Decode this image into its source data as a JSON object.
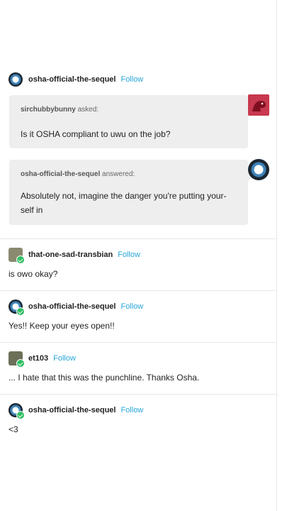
{
  "original_post": {
    "blog_name": "osha-official-the-sequel",
    "follow_label": "Follow",
    "ask": {
      "asker_name": "sirchubbybunny",
      "asked_label": "asked:",
      "question": "Is it OSHA compliant to uwu on the job?"
    },
    "answer": {
      "answerer_name": "osha-official-the-sequel",
      "answered_label": "answered:",
      "line1": "Absolutely not, imagine the danger you're putting your-",
      "line2": "self in"
    }
  },
  "replies": [
    {
      "blog_name": "that-one-sad-transbian",
      "follow_label": "Follow",
      "text": "is owo okay?"
    },
    {
      "blog_name": "osha-official-the-sequel",
      "follow_label": "Follow",
      "text": "Yes!! Keep your eyes open!!"
    },
    {
      "blog_name": "et103",
      "follow_label": "Follow",
      "text": "... I hate that this was the punchline. Thanks Osha."
    },
    {
      "blog_name": "osha-official-the-sequel",
      "follow_label": "Follow",
      "text": "<3"
    }
  ],
  "colors": {
    "accent": "#28a6d9",
    "bubble": "#eeeeee",
    "verified": "#2fbf62"
  },
  "icons": [
    "osha-avatar-icon",
    "dinosaur-avatar-icon",
    "portrait-avatar-icon",
    "verified-badge-icon"
  ]
}
